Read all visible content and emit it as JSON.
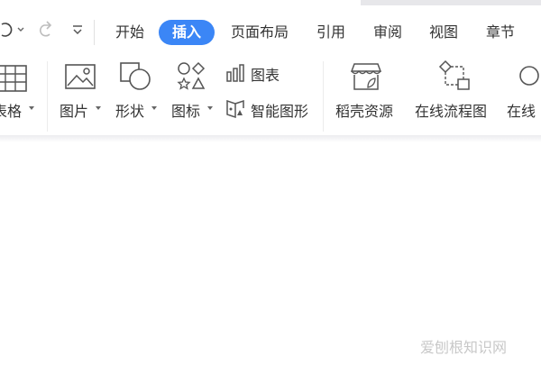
{
  "quick_access": {
    "icons": [
      "redo-arrow-icon",
      "chevron-down-icon",
      "undo-arrow-icon",
      "customize-toolbar-icon"
    ]
  },
  "tabs": [
    {
      "label": "开始",
      "active": false
    },
    {
      "label": "插入",
      "active": true
    },
    {
      "label": "页面布局",
      "active": false
    },
    {
      "label": "引用",
      "active": false
    },
    {
      "label": "审阅",
      "active": false
    },
    {
      "label": "视图",
      "active": false
    },
    {
      "label": "章节",
      "active": false
    }
  ],
  "ribbon": {
    "table_label": "表格",
    "picture_label": "图片",
    "shape_label": "形状",
    "icon_label": "图标",
    "chart_label": "图表",
    "smart_art_label": "智能图形",
    "daoke_label": "稻壳资源",
    "flowchart_label": "在线流程图",
    "mindmap_label": "在线"
  },
  "watermark": {
    "text": "爱刨根知识网"
  },
  "colors": {
    "accent": "#3b86f6",
    "icon": "#555555"
  }
}
